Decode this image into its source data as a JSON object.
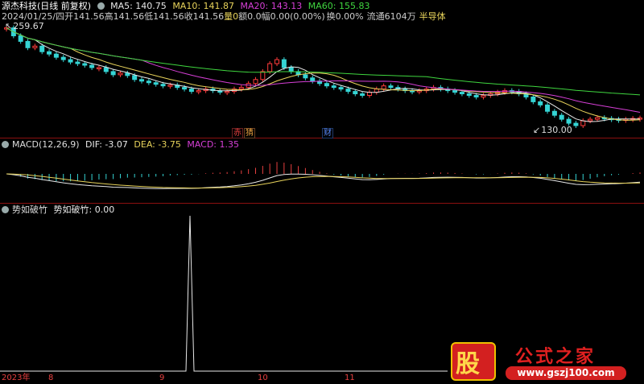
{
  "header": {
    "name": "源杰科技(日线 前复权)",
    "ma": [
      {
        "label": "MA5: 140.75",
        "color": "#e8e8e8"
      },
      {
        "label": "MA10: 141.87",
        "color": "#e8d35b"
      },
      {
        "label": "MA20: 143.13",
        "color": "#d63fd6"
      },
      {
        "label": "MA60: 155.83",
        "color": "#3fd63f"
      }
    ]
  },
  "quote": {
    "date": "2024/01/25/四",
    "open": "开141.56",
    "high": "高141.56",
    "low": "低141.56",
    "close": "收141.56",
    "vol_label": "量",
    "vol": "0",
    "amt": "额0.0",
    "chg": "幅0.00(0.00%)",
    "turn": "换0.00%",
    "float": "流通6104万",
    "sector": "半导体"
  },
  "main_chart": {
    "high_label": "259.67",
    "low_label": "130.00",
    "tags": [
      {
        "text": "赤",
        "color": "#e84040"
      },
      {
        "text": "猜",
        "color": "#e8a040"
      },
      {
        "text": "财",
        "color": "#5a8cff"
      }
    ]
  },
  "macd": {
    "title": "MACD(12,26,9)",
    "dif": "DIF: -3.07",
    "dea": "DEA: -3.75",
    "macd": "MACD: 1.35"
  },
  "indicator": {
    "title": "势如破竹",
    "value": "势如破竹: 0.00"
  },
  "xaxis": {
    "year": "2023年",
    "months": [
      "8",
      "9",
      "10",
      "11"
    ]
  },
  "watermark": {
    "stock_char": "股",
    "text": "公式之家",
    "url": "www.gszj100.com"
  },
  "chart_data": [
    {
      "type": "candlestick",
      "title": "源杰科技(日线 前复权)",
      "price_range": [
        130.0,
        259.67
      ],
      "close_series": [
        255,
        245,
        238,
        230,
        232,
        225,
        222,
        218,
        215,
        212,
        210,
        208,
        205,
        205,
        200,
        196,
        198,
        195,
        190,
        188,
        186,
        184,
        182,
        183,
        180,
        178,
        175,
        176,
        178,
        176,
        174,
        175,
        178,
        180,
        185,
        190,
        200,
        210,
        215,
        205,
        200,
        196,
        192,
        188,
        185,
        182,
        180,
        178,
        175,
        172,
        170,
        174,
        178,
        182,
        180,
        178,
        176,
        175,
        176,
        178,
        180,
        178,
        176,
        174,
        172,
        170,
        168,
        170,
        172,
        174,
        176,
        175,
        172,
        168,
        162,
        158,
        150,
        145,
        140,
        135,
        132,
        138,
        140,
        142,
        141,
        140,
        139,
        140,
        141,
        141.56
      ],
      "ma": [
        "MA5",
        "MA10",
        "MA20",
        "MA60"
      ]
    },
    {
      "type": "bar",
      "title": "MACD(12,26,9)",
      "series": [
        {
          "name": "DIF",
          "value": -3.07
        },
        {
          "name": "DEA",
          "value": -3.75
        },
        {
          "name": "MACD",
          "value": 1.35
        }
      ]
    },
    {
      "type": "line",
      "title": "势如破竹",
      "peak_at": "9",
      "series": [
        {
          "name": "势如破竹",
          "value": 0.0
        }
      ]
    }
  ]
}
